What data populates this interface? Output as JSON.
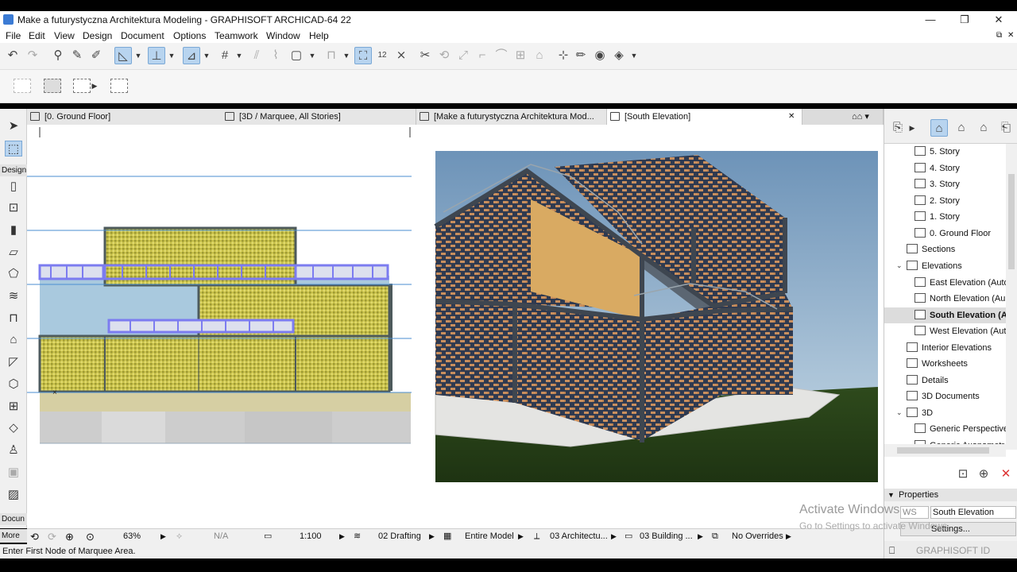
{
  "window": {
    "title": "Make a futurystyczna Architektura Modeling - GRAPHISOFT ARCHICAD-64 22",
    "minimize_glyph": "—",
    "restore_glyph": "❐",
    "close_glyph": "✕"
  },
  "menu": [
    "File",
    "Edit",
    "View",
    "Design",
    "Document",
    "Options",
    "Teamwork",
    "Window",
    "Help"
  ],
  "toolbox": {
    "design_label": "Design",
    "document_label": "Docun",
    "more_label": "More"
  },
  "tabs": [
    {
      "label": "[0. Ground Floor]",
      "icon": "floor-plan-icon"
    },
    {
      "label": "[3D / Marquee, All Stories]",
      "icon": "3d-window-icon"
    },
    {
      "label": "[Make a futurystyczna Architektura Mod...",
      "icon": "camera-icon"
    },
    {
      "label": "[South Elevation]",
      "icon": "elevation-icon",
      "close": "✕"
    }
  ],
  "navigator": {
    "items": [
      {
        "label": "5. Story",
        "level": 2
      },
      {
        "label": "4. Story",
        "level": 2
      },
      {
        "label": "3. Story",
        "level": 2
      },
      {
        "label": "2. Story",
        "level": 2
      },
      {
        "label": "1. Story",
        "level": 2
      },
      {
        "label": "0. Ground Floor",
        "level": 2
      },
      {
        "label": "Sections",
        "level": 1
      },
      {
        "label": "Elevations",
        "level": 1,
        "expanded": true
      },
      {
        "label": "East Elevation (Auto",
        "level": 2
      },
      {
        "label": "North Elevation (Au",
        "level": 2
      },
      {
        "label": "South Elevation (Au",
        "level": 2,
        "selected": true
      },
      {
        "label": "West Elevation (Aut",
        "level": 2
      },
      {
        "label": "Interior Elevations",
        "level": 1
      },
      {
        "label": "Worksheets",
        "level": 1
      },
      {
        "label": "Details",
        "level": 1
      },
      {
        "label": "3D Documents",
        "level": 1
      },
      {
        "label": "3D",
        "level": 1,
        "expanded": true
      },
      {
        "label": "Generic Perspective",
        "level": 2
      },
      {
        "label": "Generic Axonometr",
        "level": 2
      }
    ]
  },
  "properties": {
    "header": "Properties",
    "id_label": "WS",
    "name_value": "South Elevation",
    "settings_button": "Settings..."
  },
  "statusbar": {
    "zoom": "63%",
    "angle": "N/A",
    "scale": "1:100",
    "layer_combo": "02 Drafting",
    "model_filter": "Entire Model",
    "pen_set": "03 Architectu...",
    "mvo": "03 Building ...",
    "graphic_overrides": "No Overrides"
  },
  "hint": "Enter First Node of Marquee Area.",
  "graphisoft_id": "GRAPHISOFT ID",
  "watermark": {
    "line1": "Activate Windows",
    "line2": "Go to Settings to activate Windows."
  },
  "colors": {
    "accent_blue": "#3b7bd4",
    "facade_yellow": "#c8c24a",
    "sky_blue": "#b9cfe0",
    "railing_purple": "#7c7cf0",
    "brick": "#c98f5e"
  }
}
